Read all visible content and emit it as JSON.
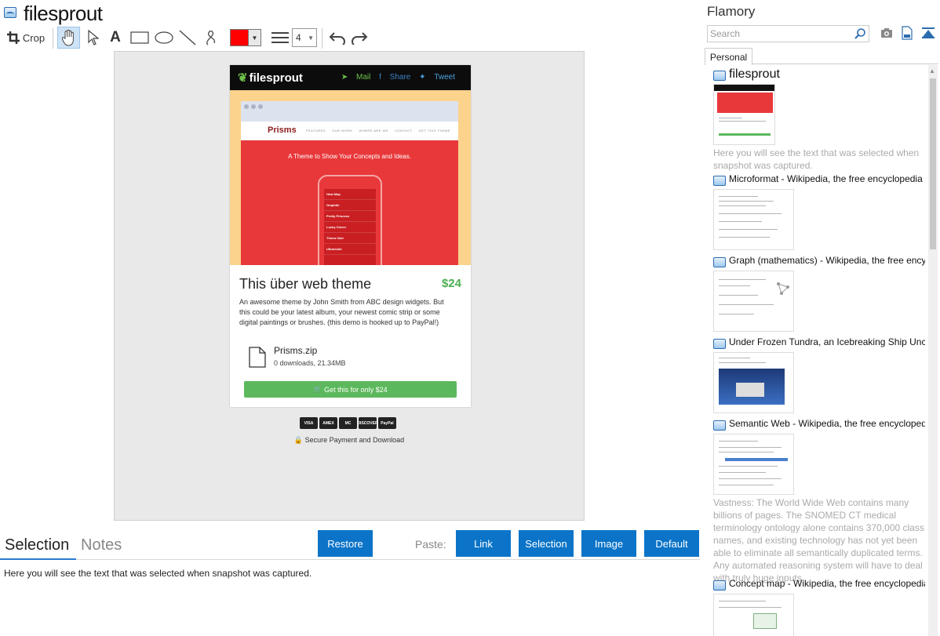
{
  "document": {
    "title": "filesprout"
  },
  "toolbar": {
    "crop_label": "Crop",
    "text_tool": "A",
    "color_hex": "#ff0000",
    "line_width": "4"
  },
  "snapshot": {
    "brand": "filesprout",
    "links": {
      "mail": "Mail",
      "share": "Share",
      "tweet": "Tweet"
    },
    "theme_brand": "Prisms",
    "theme_menu": [
      "FEATURES",
      "OUR WORK",
      "WHERE ARE WE",
      "CONTACT",
      "GET THIS THEME"
    ],
    "hero_tagline": "A Theme to Show Your Concepts and Ideas.",
    "phone_rows": [
      "Heat Map",
      "Graphite",
      "Pretty Princess",
      "Lucky Clover",
      "Theme Noir",
      "Ultraviolet"
    ],
    "product_title": "This über web theme",
    "price": "$24",
    "description": "An awesome theme by John Smith from ABC design widgets. But this could be your latest album, your newest comic strip or some digital paintings or brushes. (this demo is hooked up to PayPal!)",
    "file_name": "Prisms.zip",
    "file_meta": "0 downloads, 21.34MB",
    "buy_label": "Get this for only $24",
    "payment_cards": [
      "VISA",
      "AMEX",
      "MC",
      "DISCOVER",
      "PayPal"
    ],
    "secure_text": "Secure Payment and Download"
  },
  "bottom": {
    "tabs": [
      "Selection",
      "Notes"
    ],
    "restore_label": "Restore",
    "paste_label": "Paste:",
    "paste_buttons": [
      "Link",
      "Selection",
      "Image",
      "Default"
    ],
    "selection_text": "Here you will see the text that was selected when snapshot was captured."
  },
  "panel": {
    "title": "Flamory",
    "search_placeholder": "Search",
    "tabs": [
      "Personal"
    ],
    "items": [
      {
        "title": "filesprout",
        "desc": "Here you will see the text that was selected when snapshot was captured."
      },
      {
        "title": "Microformat - Wikipedia, the free encyclopedia",
        "desc": ""
      },
      {
        "title": "Graph (mathematics) - Wikipedia, the free encyclopedia",
        "desc": ""
      },
      {
        "title": "Under Frozen Tundra, an Icebreaking Ship Uncovers",
        "desc": ""
      },
      {
        "title": "Semantic Web - Wikipedia, the free encyclopedia",
        "desc": "Vastness: The World Wide Web contains many billions of pages. The SNOMED CT medical terminology ontology alone contains 370,000 class names, and existing technology has not yet been able to eliminate all semantically duplicated terms. Any automated reasoning system will have to deal with truly huge inputs."
      },
      {
        "title": "Concept map - Wikipedia, the free encyclopedia",
        "desc": ""
      }
    ]
  }
}
